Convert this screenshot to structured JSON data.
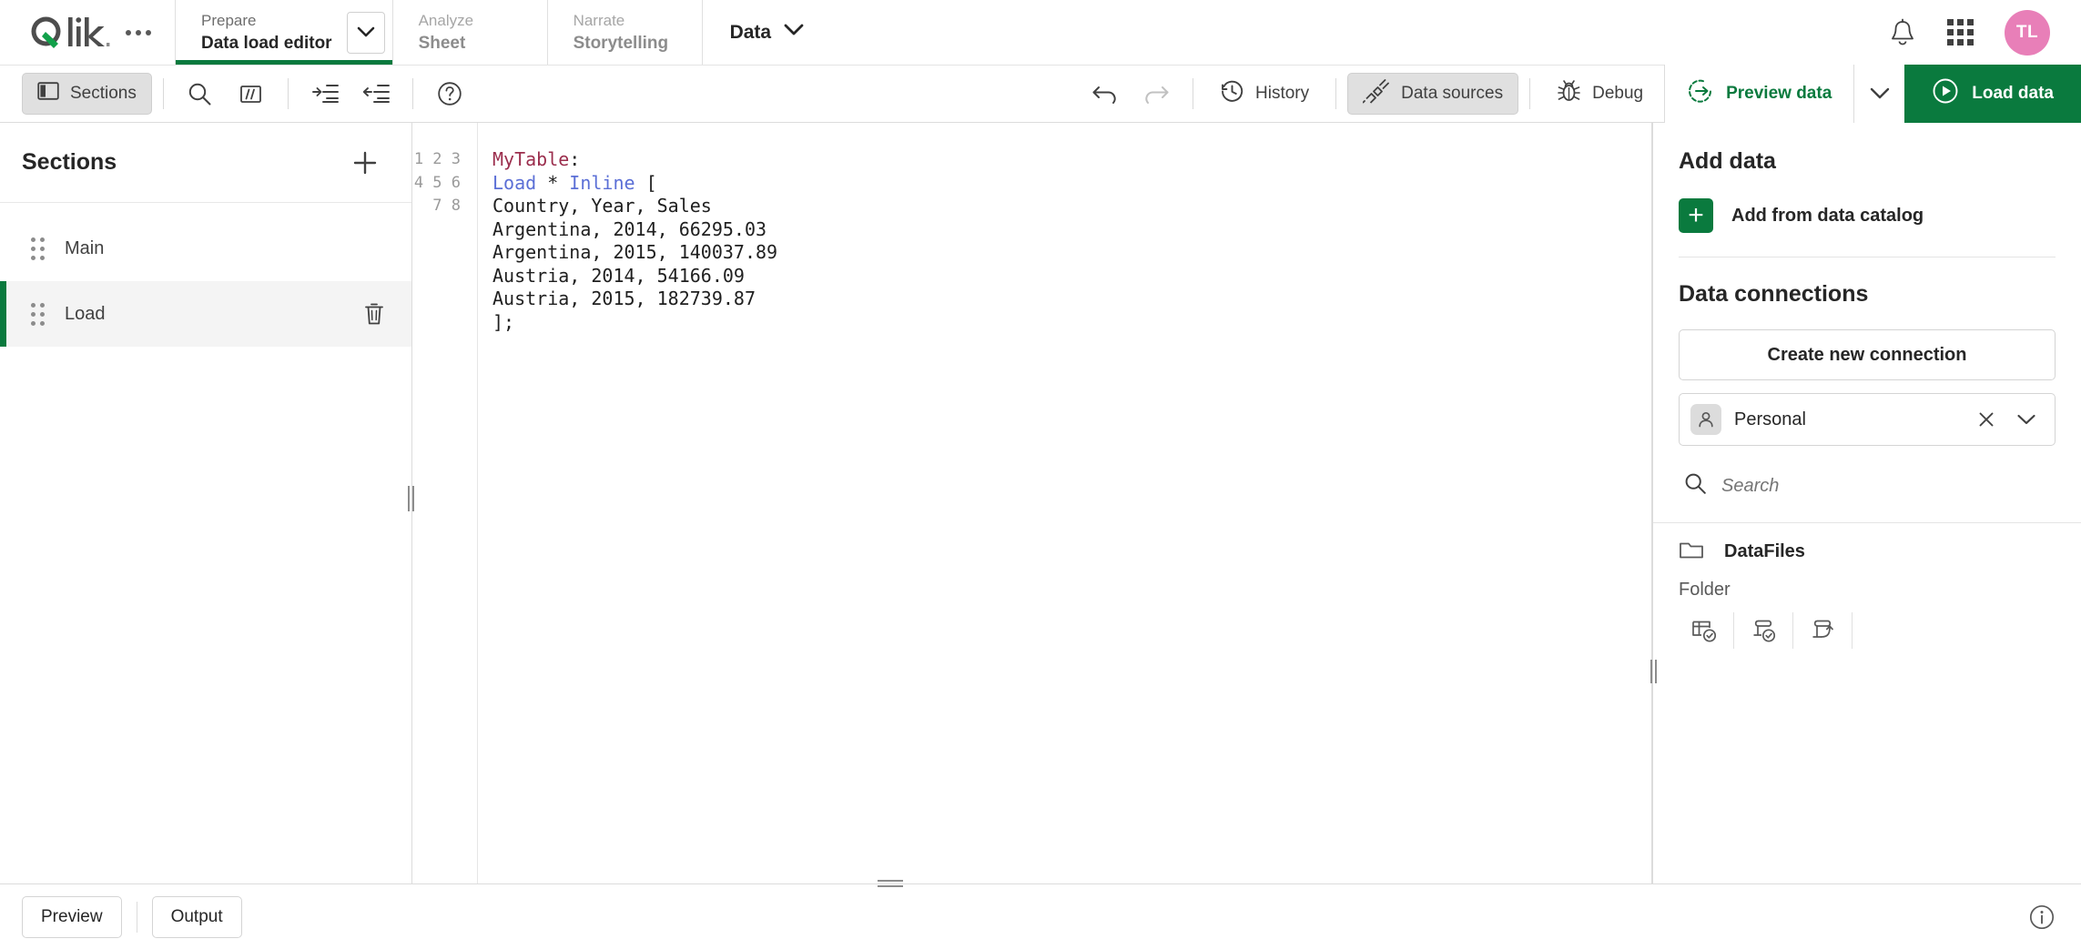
{
  "app": {
    "logo_text": "Qlik",
    "overflow_menu": "more-menu"
  },
  "hub_tabs": [
    {
      "kicker": "Prepare",
      "name": "Data load editor",
      "active": true
    },
    {
      "kicker": "Analyze",
      "name": "Sheet",
      "active": false
    },
    {
      "kicker": "Narrate",
      "name": "Storytelling",
      "active": false
    }
  ],
  "data_menu": {
    "label": "Data"
  },
  "topbar_right": {
    "notifications": "notification-bell",
    "app_grid": "app-grid",
    "avatar_initials": "TL",
    "avatar_color": "#e87fb8"
  },
  "toolbar": {
    "sections_label": "Sections",
    "search_icon": "search-icon",
    "comment_icon": "comment-icon",
    "indent_icon": "indent-icon",
    "outdent_icon": "outdent-icon",
    "help_icon": "help-icon",
    "undo_icon": "undo-icon",
    "redo_icon": "redo-icon",
    "history_label": "History",
    "data_sources_label": "Data sources",
    "debug_label": "Debug",
    "preview_data_label": "Preview data",
    "load_data_label": "Load data",
    "accent_green": "#0a7a3e"
  },
  "sections": {
    "title": "Sections",
    "add_label": "+",
    "items": [
      {
        "name": "Main",
        "selected": false
      },
      {
        "name": "Load",
        "selected": true
      }
    ]
  },
  "editor": {
    "line_numbers": [
      "1",
      "2",
      "3",
      "4",
      "5",
      "6",
      "7",
      "8"
    ],
    "lines": [
      {
        "tokens": [
          {
            "t": "MyTable",
            "k": "table"
          },
          {
            "t": ":",
            "k": "plain"
          }
        ]
      },
      {
        "tokens": [
          {
            "t": "Load",
            "k": "kw"
          },
          {
            "t": " * ",
            "k": "plain"
          },
          {
            "t": "Inline",
            "k": "kw"
          },
          {
            "t": " [",
            "k": "plain"
          }
        ]
      },
      {
        "tokens": [
          {
            "t": "Country, Year, Sales",
            "k": "plain"
          }
        ]
      },
      {
        "tokens": [
          {
            "t": "Argentina, 2014, 66295.03",
            "k": "plain"
          }
        ]
      },
      {
        "tokens": [
          {
            "t": "Argentina, 2015, 140037.89",
            "k": "plain"
          }
        ]
      },
      {
        "tokens": [
          {
            "t": "Austria, 2014, 54166.09",
            "k": "plain"
          }
        ]
      },
      {
        "tokens": [
          {
            "t": "Austria, 2015, 182739.87",
            "k": "plain"
          }
        ]
      },
      {
        "tokens": [
          {
            "t": "];",
            "k": "plain"
          }
        ]
      }
    ]
  },
  "data_panel": {
    "add_data_title": "Add data",
    "add_from_catalog_label": "Add from data catalog",
    "data_connections_title": "Data connections",
    "create_new_connection_label": "Create new connection",
    "space": {
      "value": "Personal",
      "clear": "×",
      "caret": "chevron-down"
    },
    "search": {
      "placeholder": "Search",
      "value": ""
    },
    "connections": [
      {
        "name": "DataFiles",
        "type": "Folder"
      }
    ],
    "connection_actions": [
      "select-data-icon",
      "select-script-icon",
      "insert-script-icon"
    ]
  },
  "bottom": {
    "preview_label": "Preview",
    "output_label": "Output",
    "info_icon": "info-icon"
  }
}
